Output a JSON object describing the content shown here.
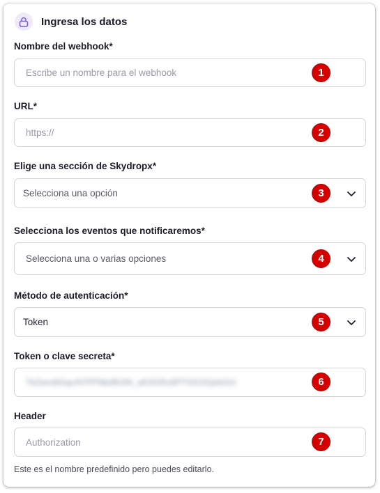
{
  "header": {
    "title": "Ingresa los datos",
    "icon": "lock-icon",
    "accent": "#7b5fd6"
  },
  "fields": {
    "name": {
      "label": "Nombre del webhook*",
      "placeholder": "Escribe un nombre para el webhook",
      "marker": "1"
    },
    "url": {
      "label": "URL*",
      "placeholder": "https://",
      "marker": "2"
    },
    "section": {
      "label": "Elige una sección de Skydropx*",
      "placeholder": "Selecciona una opción",
      "marker": "3"
    },
    "events": {
      "label": "Selecciona los eventos que notificaremos*",
      "placeholder": "Selecciona una o varias opciones",
      "marker": "4"
    },
    "auth": {
      "label": "Método de autenticación*",
      "value": "Token",
      "marker": "5"
    },
    "token": {
      "label": "Token o clave secreta*",
      "value": "TkZwvdtGqcAYPPNkd9UNI_aK5GRu5PTG0J2Qek2oI",
      "marker": "6"
    },
    "header_field": {
      "label": "Header",
      "placeholder": "Authorization",
      "marker": "7",
      "help": "Este es el nombre predefinido pero puedes editarlo."
    }
  },
  "colors": {
    "marker": "#d40000",
    "border": "#d4d4da"
  }
}
